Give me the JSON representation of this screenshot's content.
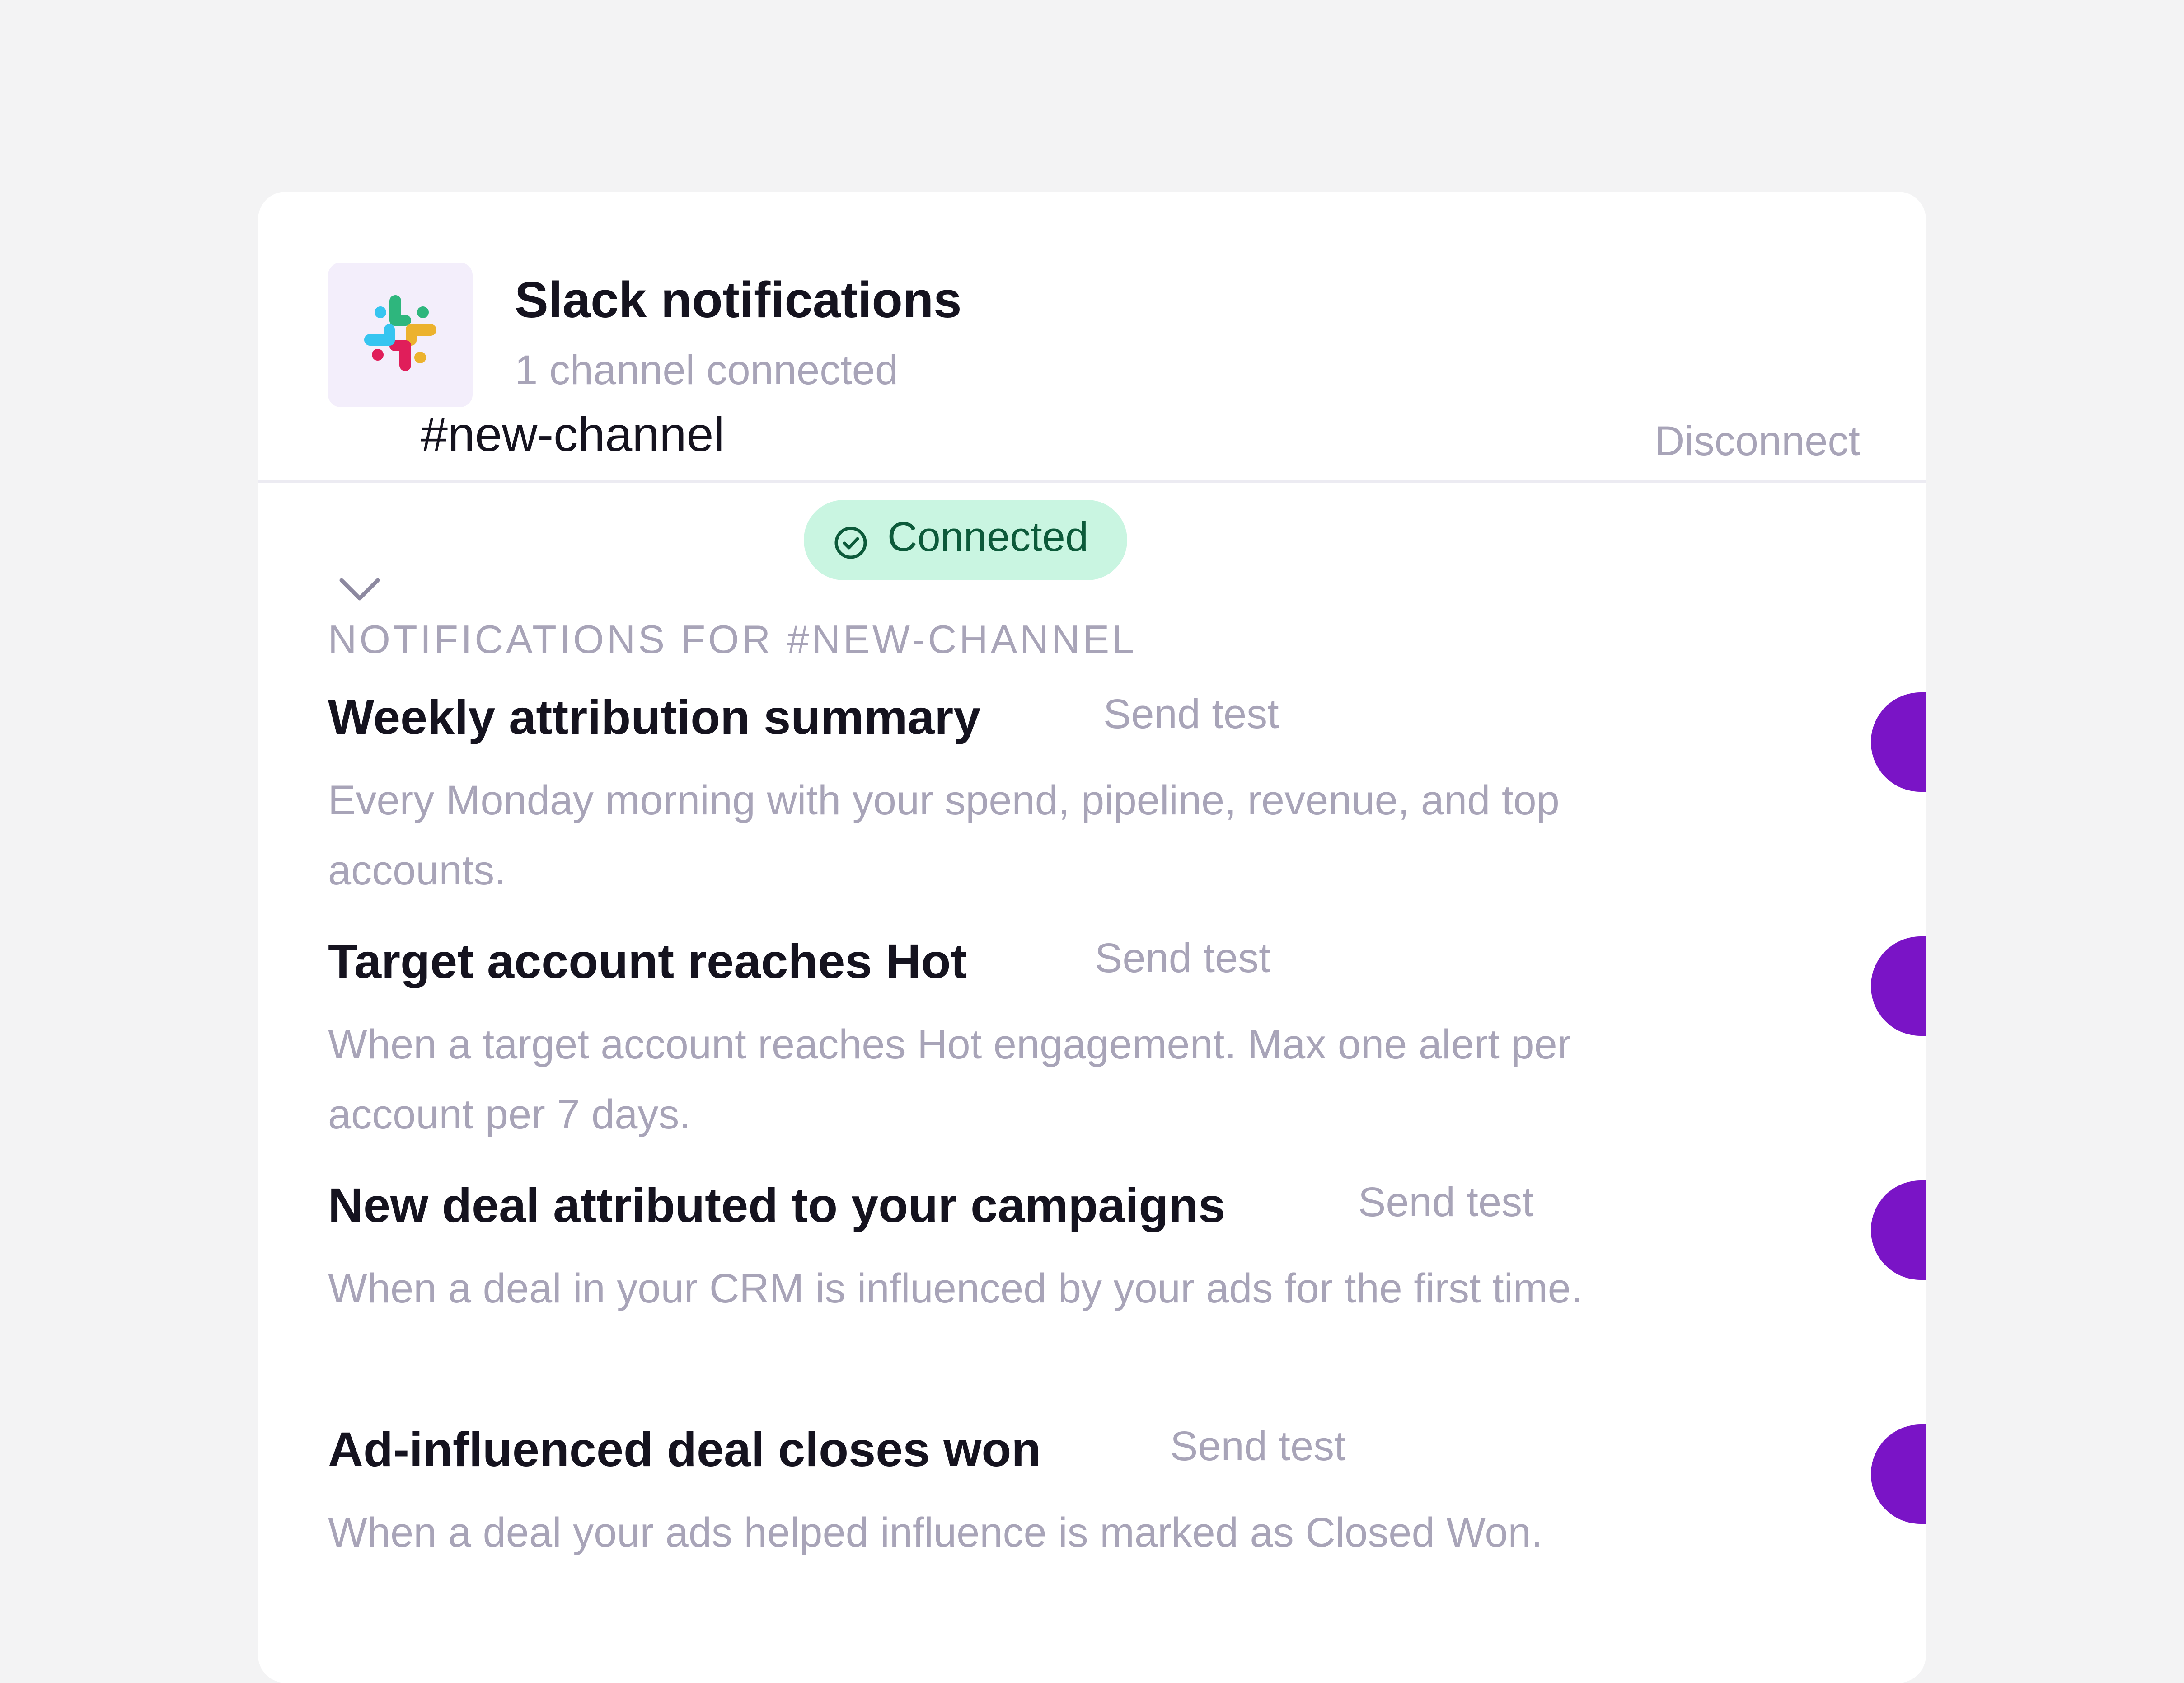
{
  "header": {
    "title": "Slack notifications",
    "subtitle": "1 channel connected",
    "logo_icon": "slack-logo-icon"
  },
  "channel": {
    "name": "#new-channel",
    "status_label": "Connected",
    "status_icon": "check-circle-icon",
    "disconnect_label": "Disconnect",
    "section_label": "NOTIFICATIONS FOR #NEW-CHANNEL"
  },
  "notifications": [
    {
      "title": "Weekly attribution summary",
      "send_test_label": "Send test",
      "description": "Every Monday morning with your spend, pipeline, revenue, and top accounts.",
      "enabled": true
    },
    {
      "title": "Target account reaches Hot",
      "send_test_label": "Send test",
      "description": "When a target account reaches Hot engagement. Max one alert per account per 7 days.",
      "enabled": true
    },
    {
      "title": "New deal attributed to your campaigns",
      "send_test_label": "Send test",
      "description": "When a deal in your CRM is influenced by your ads for the first time.",
      "enabled": true
    },
    {
      "title": "Ad-influenced deal closes won",
      "send_test_label": "Send test",
      "description": "When a deal your ads helped influence is marked as Closed Won.",
      "enabled": true
    }
  ],
  "colors": {
    "toggle_on": "#7a14c6",
    "badge_bg": "#c9f5e1",
    "badge_text": "#0c5a3a",
    "muted_text": "#a8a4b8"
  }
}
